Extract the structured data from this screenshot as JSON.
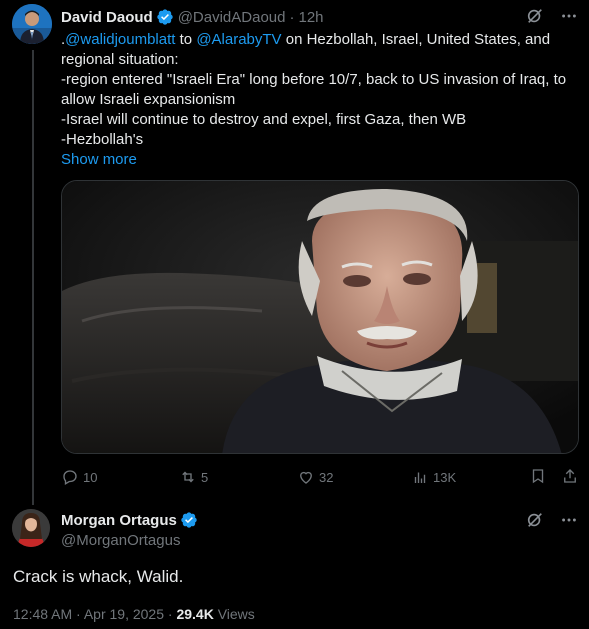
{
  "tweet": {
    "author_name": "David Daoud",
    "author_handle": "@DavidADaoud",
    "time": "12h",
    "text_prefix": ".",
    "mention_1": "@walidjoumblatt",
    "to_word": " to ",
    "mention_2": "@AlarabyTV",
    "line1_suffix": " on Hezbollah, Israel, United States, and",
    "line2": "regional situation:",
    "line3": "-region entered \"Israeli Era\" long before 10/7, back to US invasion of Iraq, to",
    "line4": "allow Israeli expansionism",
    "line5": "-Israel will continue to destroy and expel, first Gaza, then WB",
    "line6": "-Hezbollah's",
    "show_more": "Show more",
    "actions": {
      "replies": "10",
      "reposts": "5",
      "likes": "32",
      "views": "13K"
    }
  },
  "reply": {
    "author_name": "Morgan Ortagus",
    "author_handle": "@MorganOrtagus",
    "text": "Crack is whack, Walid.",
    "timestamp": "12:48 AM · Apr 19, 2025",
    "separator": " · ",
    "views_count": "29.4K",
    "views_label": " Views"
  },
  "colors": {
    "background": "#000000",
    "text": "#e7e9ea",
    "muted": "#71767b",
    "link": "#1d9bf0",
    "verified": "#1d9bf0"
  }
}
